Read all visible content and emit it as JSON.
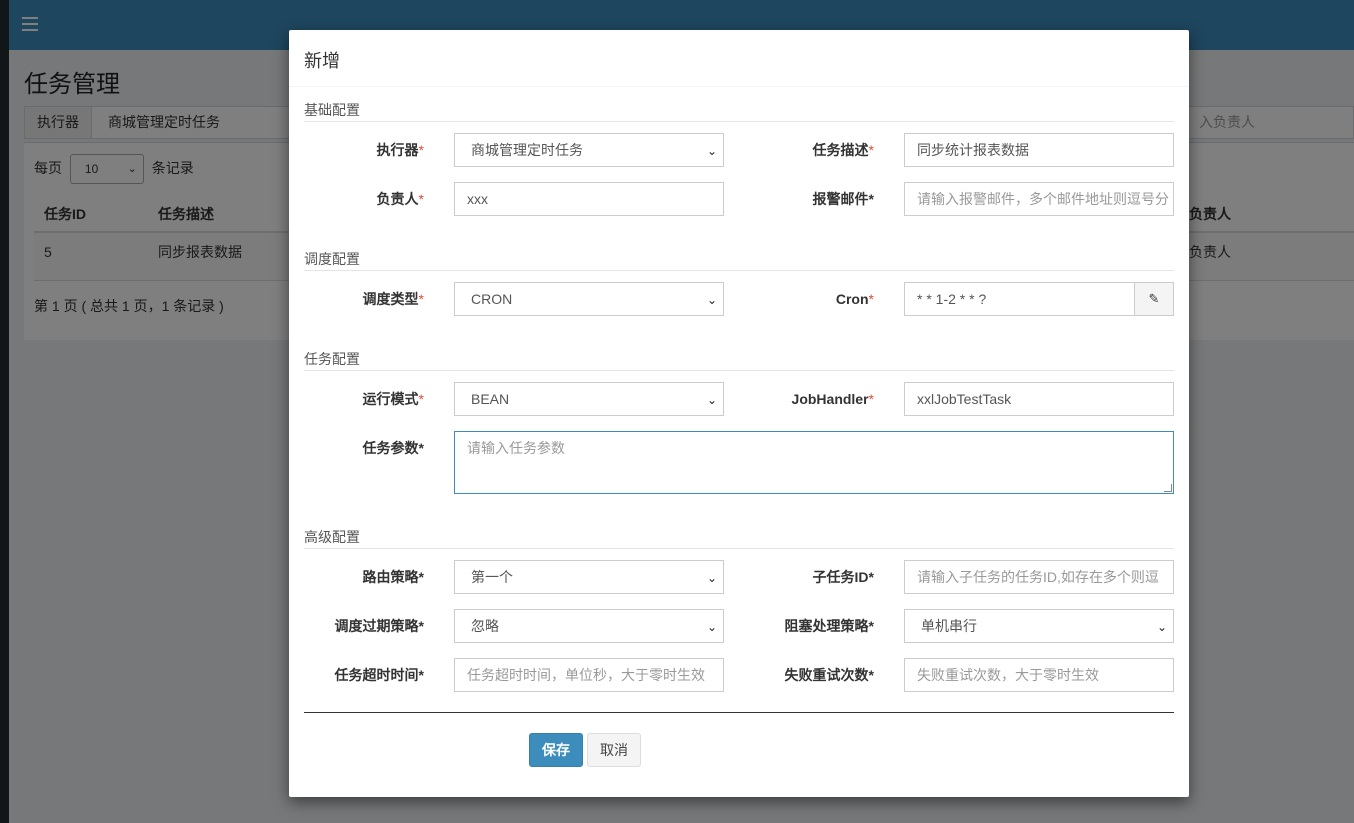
{
  "background": {
    "page_title": "任务管理",
    "filter": {
      "executor_label": "执行器",
      "executor_value": "商城管理定时任务",
      "owner_placeholder_fragment": "入负责人"
    },
    "per_page": {
      "prefix": "每页",
      "value": "10",
      "suffix": "条记录"
    },
    "table": {
      "headers": [
        "任务ID",
        "任务描述",
        "负责人"
      ],
      "rows": [
        {
          "id": "5",
          "desc": "同步报表数据",
          "owner": "负责人"
        }
      ]
    },
    "pager_text": "第 1 页 ( 总共 1 页，1 条记录 )"
  },
  "modal": {
    "title": "新增",
    "sections": {
      "basic": "基础配置",
      "schedule": "调度配置",
      "task": "任务配置",
      "advanced": "高级配置"
    },
    "fields": {
      "executor": {
        "label": "执行器",
        "value": "商城管理定时任务"
      },
      "job_desc": {
        "label": "任务描述",
        "value": "同步统计报表数据"
      },
      "author": {
        "label": "负责人",
        "value": "xxx"
      },
      "alarm_email": {
        "label": "报警邮件",
        "placeholder": "请输入报警邮件，多个邮件地址则逗号分"
      },
      "schedule_type": {
        "label": "调度类型",
        "value": "CRON"
      },
      "cron": {
        "label": "Cron",
        "value": "* * 1-2 * * ?"
      },
      "glue_type": {
        "label": "运行模式",
        "value": "BEAN"
      },
      "job_handler": {
        "label": "JobHandler",
        "value": "xxlJobTestTask"
      },
      "job_param": {
        "label": "任务参数",
        "placeholder": "请输入任务参数"
      },
      "route_strategy": {
        "label": "路由策略",
        "value": "第一个"
      },
      "child_job_id": {
        "label": "子任务ID",
        "placeholder": "请输入子任务的任务ID,如存在多个则逗"
      },
      "misfire_strategy": {
        "label": "调度过期策略",
        "value": "忽略"
      },
      "block_strategy": {
        "label": "阻塞处理策略",
        "value": "单机串行"
      },
      "timeout": {
        "label": "任务超时时间",
        "placeholder": "任务超时时间，单位秒，大于零时生效"
      },
      "fail_retry": {
        "label": "失败重试次数",
        "placeholder": "失败重试次数，大于零时生效"
      }
    },
    "buttons": {
      "save": "保存",
      "cancel": "取消"
    }
  },
  "colors": {
    "primary": "#3c8dbc",
    "required": "#dd4b39",
    "sidebar": "#222d32"
  }
}
